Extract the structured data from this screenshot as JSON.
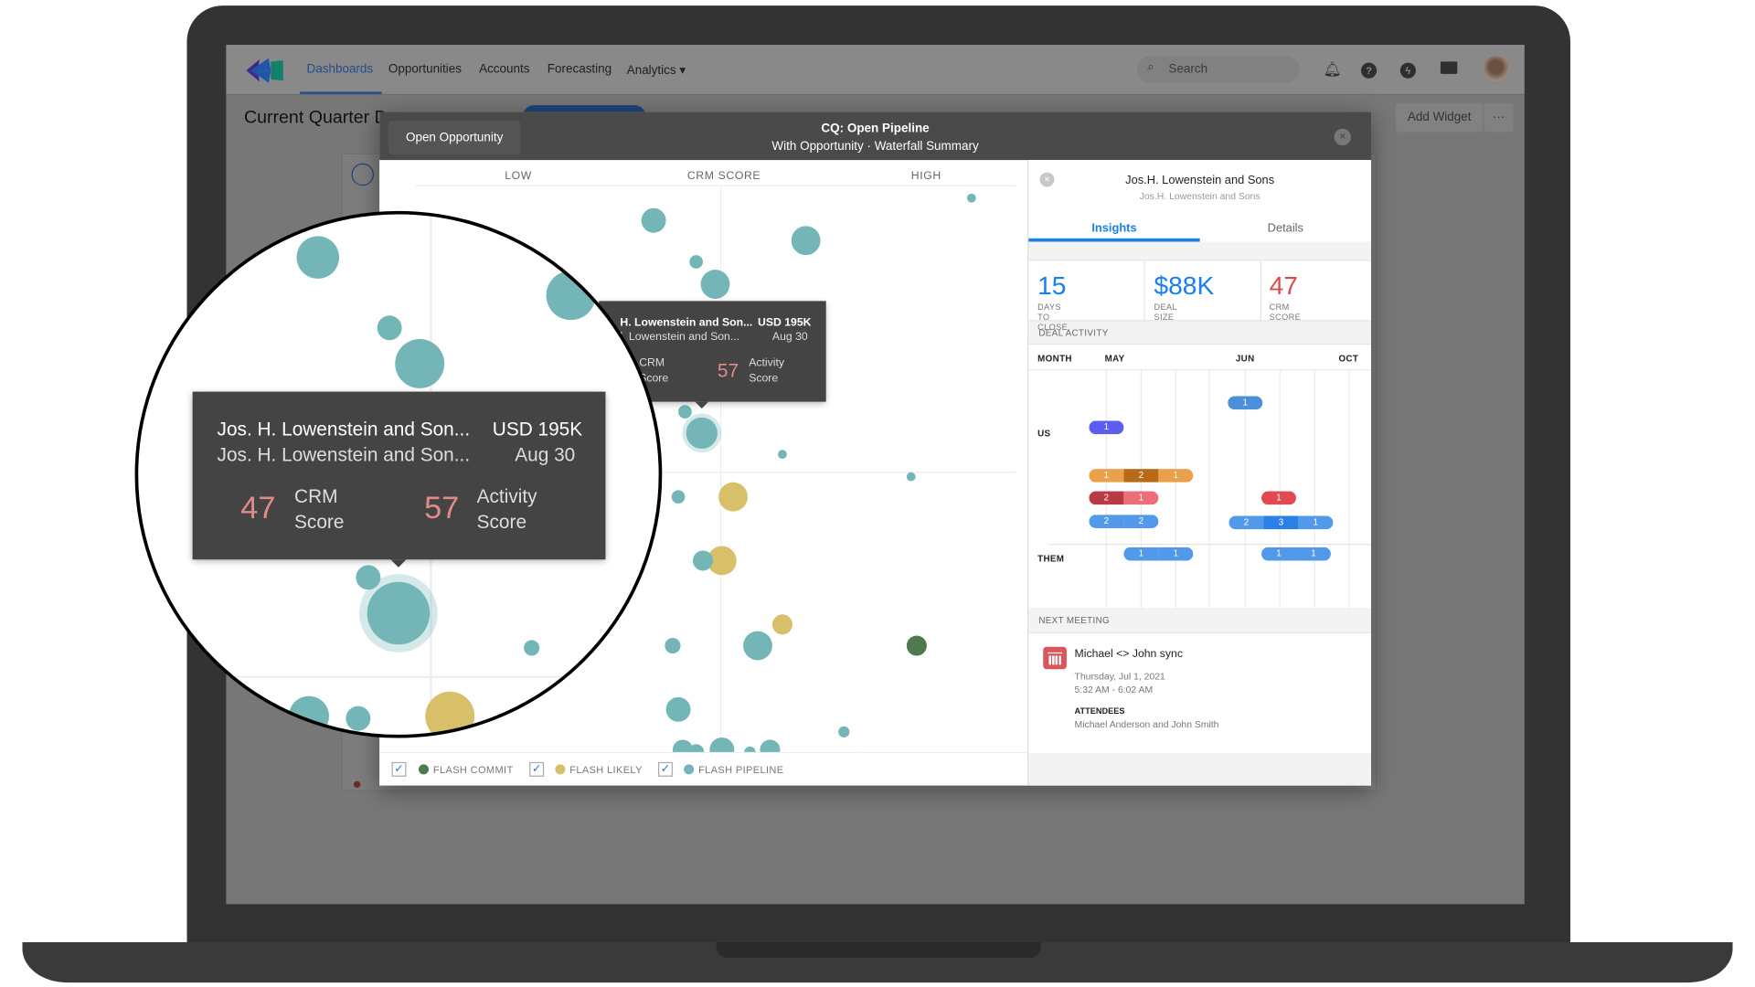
{
  "nav": {
    "items": [
      "Dashboards",
      "Opportunities",
      "Accounts",
      "Forecasting",
      "Analytics"
    ],
    "active": "Dashboards",
    "search_placeholder": "Search"
  },
  "page": {
    "title": "Current Quarter D",
    "add_widget": "Add Widget",
    "more": "···"
  },
  "modal": {
    "open_opportunity": "Open Opportunity",
    "title": "CQ: Open Pipeline",
    "subtitle": "With Opportunity · Waterfall Summary",
    "close": "×",
    "axis": {
      "low": "LOW",
      "mid": "CRM SCORE",
      "high": "HIGH"
    },
    "legend": [
      {
        "label": "FLASH COMMIT",
        "color": "#4f7a4f",
        "checked": true
      },
      {
        "label": "FLASH LIKELY",
        "color": "#d8bf6a",
        "checked": true
      },
      {
        "label": "FLASH PIPELINE",
        "color": "#74b6b7",
        "checked": true
      }
    ],
    "tooltip": {
      "name": "Jos. H. Lowenstein and Son...",
      "amount": "USD 195K",
      "account": "Jos. H. Lowenstein and Son...",
      "date": "Aug 30",
      "crm_score": "47",
      "crm_label_1": "CRM",
      "crm_label_2": "Score",
      "activity_score": "57",
      "activity_label_1": "Activity",
      "activity_label_2": "Score"
    },
    "tooltip_small": {
      "name": "H. Lowenstein and Son...",
      "amount": "USD 195K",
      "account": "l. Lowenstein and Son...",
      "date": "Aug 30",
      "crm_label_1": "CRM",
      "crm_label_2": "Score",
      "activity_score": "57",
      "activity_label_1": "Activity",
      "activity_label_2": "Score"
    }
  },
  "panel": {
    "close": "×",
    "title": "Jos.H. Lowenstein and Sons",
    "subtitle": "Jos.H. Lowenstein and Sons",
    "tabs": [
      "Insights",
      "Details"
    ],
    "active_tab": "Insights",
    "metrics": [
      {
        "value": "15",
        "label": "DAYS TO CLOSE",
        "color": "#1a7fe8"
      },
      {
        "value": "$88K",
        "label": "DEAL SIZE",
        "color": "#1a7fe8"
      },
      {
        "value": "47",
        "label": "CRM SCORE",
        "color": "#e04848"
      }
    ],
    "deal_activity": {
      "header": "DEAL ACTIVITY",
      "columns": {
        "month": "MONTH",
        "may": "MAY",
        "jun": "JUN",
        "oct": "OCT"
      },
      "rows": {
        "us": "US",
        "them": "THEM"
      },
      "bars": [
        {
          "group": "us",
          "segments": [
            {
              "v": "1",
              "c": "#4a90d9"
            }
          ]
        },
        {
          "group": "us",
          "segments": [
            {
              "v": "1",
              "c": "#5b5ef0"
            }
          ]
        },
        {
          "group": "us",
          "segments": [
            {
              "v": "1",
              "c": "#eba04a"
            },
            {
              "v": "2",
              "c": "#b86a16"
            },
            {
              "v": "1",
              "c": "#eba04a"
            }
          ]
        },
        {
          "group": "us",
          "segments": [
            {
              "v": "2",
              "c": "#b83a42"
            },
            {
              "v": "1",
              "c": "#ec6e76"
            }
          ]
        },
        {
          "group": "us",
          "segments": [
            {
              "v": "1",
              "c": "#e24a52"
            }
          ]
        },
        {
          "group": "us",
          "segments": [
            {
              "v": "2",
              "c": "#5299ea"
            },
            {
              "v": "2",
              "c": "#5299ea"
            }
          ]
        },
        {
          "group": "us",
          "segments": [
            {
              "v": "2",
              "c": "#5299ea"
            },
            {
              "v": "3",
              "c": "#2a80e6"
            },
            {
              "v": "1",
              "c": "#5299ea"
            }
          ]
        },
        {
          "group": "them",
          "segments": [
            {
              "v": "1",
              "c": "#5299ea"
            },
            {
              "v": "1",
              "c": "#5299ea"
            }
          ]
        },
        {
          "group": "them",
          "segments": [
            {
              "v": "1",
              "c": "#5299ea"
            },
            {
              "v": "1",
              "c": "#5299ea"
            }
          ]
        }
      ]
    },
    "next_meeting": {
      "header": "NEXT MEETING",
      "title": "Michael <> John sync",
      "date": "Thursday, Jul 1, 2021",
      "time": "5:32 AM - 6:02 AM",
      "attendees_label": "ATTENDEES",
      "attendees": "Michael Anderson and John Smith"
    }
  }
}
